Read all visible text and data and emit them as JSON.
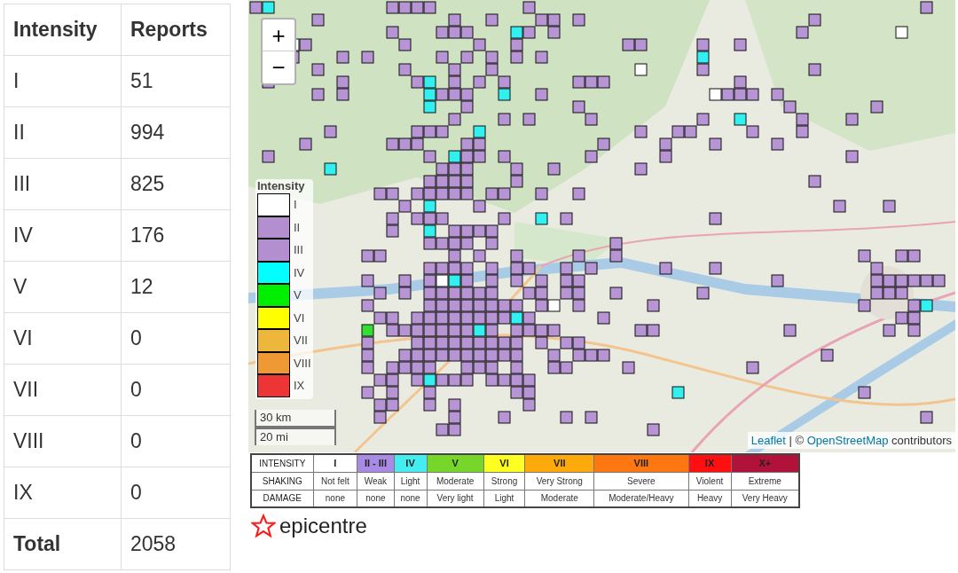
{
  "reports_table": {
    "columns": [
      "Intensity",
      "Reports"
    ],
    "rows": [
      {
        "intensity": "I",
        "reports": "51"
      },
      {
        "intensity": "II",
        "reports": "994"
      },
      {
        "intensity": "III",
        "reports": "825"
      },
      {
        "intensity": "IV",
        "reports": "176"
      },
      {
        "intensity": "V",
        "reports": "12"
      },
      {
        "intensity": "VI",
        "reports": "0"
      },
      {
        "intensity": "VII",
        "reports": "0"
      },
      {
        "intensity": "VIII",
        "reports": "0"
      },
      {
        "intensity": "IX",
        "reports": "0"
      }
    ],
    "total": {
      "label": "Total",
      "reports": "2058"
    }
  },
  "map": {
    "zoom_in": "+",
    "zoom_out": "−",
    "legend": {
      "title": "Intensity",
      "items": [
        {
          "label": "I",
          "color": "#ffffff"
        },
        {
          "label": "II",
          "color": "#b48fd0"
        },
        {
          "label": "III",
          "color": "#b48fd0"
        },
        {
          "label": "IV",
          "color": "#00ffff"
        },
        {
          "label": "V",
          "color": "#00ee00"
        },
        {
          "label": "VI",
          "color": "#ffff00"
        },
        {
          "label": "VII",
          "color": "#ecb73a"
        },
        {
          "label": "VIII",
          "color": "#ef9935"
        },
        {
          "label": "IX",
          "color": "#ee3535"
        }
      ]
    },
    "scale": [
      "30 km",
      "20 mi"
    ],
    "attribution": {
      "links": [
        "Leaflet",
        "OpenStreetMap"
      ],
      "separator": " | © ",
      "suffix": " contributors"
    }
  },
  "intensity_scale": {
    "row_labels": [
      "INTENSITY",
      "SHAKING",
      "DAMAGE"
    ],
    "levels": [
      {
        "label": "I",
        "color": "#ffffff",
        "shaking": "Not felt",
        "damage": "none"
      },
      {
        "label": "II - III",
        "color": "#a98be6",
        "shaking": "Weak",
        "damage": "none"
      },
      {
        "label": "IV",
        "color": "#44eef0",
        "shaking": "Light",
        "damage": "none"
      },
      {
        "label": "V",
        "color": "#77d62a",
        "shaking": "Moderate",
        "damage": "Very light"
      },
      {
        "label": "VI",
        "color": "#ffff22",
        "shaking": "Strong",
        "damage": "Light"
      },
      {
        "label": "VII",
        "color": "#ffaa0c",
        "shaking": "Very Strong",
        "damage": "Moderate"
      },
      {
        "label": "VIII",
        "color": "#ff7711",
        "shaking": "Severe",
        "damage": "Moderate/Heavy"
      },
      {
        "label": "IX",
        "color": "#ff0f0f",
        "shaking": "Violent",
        "damage": "Heavy"
      },
      {
        "label": "X+",
        "color": "#b0123a",
        "shaking": "Extreme",
        "damage": "Very Heavy"
      }
    ]
  },
  "logo": {
    "text": "epicentre"
  }
}
